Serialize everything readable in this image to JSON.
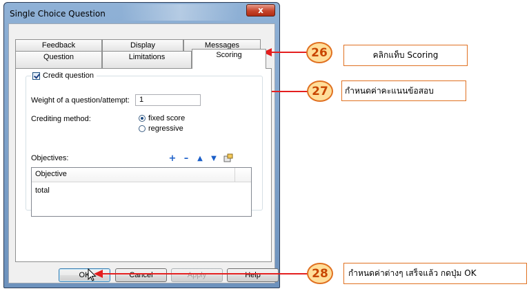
{
  "dialog": {
    "title": "Single Choice Question",
    "close_label": "x"
  },
  "tabs": {
    "back_row": [
      "Feedback",
      "Display",
      "Messages"
    ],
    "front_row": [
      "Question",
      "Limitations",
      "Scoring"
    ],
    "active": "Scoring"
  },
  "scoring": {
    "credit_checkbox_label": "Credit question",
    "credit_checked": true,
    "weight_label": "Weight of a question/attempt:",
    "weight_value": "1",
    "crediting_label": "Crediting method:",
    "crediting_options": [
      "fixed score",
      "regressive"
    ],
    "crediting_selected": "fixed score",
    "objectives_label": "Objectives:",
    "objective_tools": [
      "add-icon",
      "remove-icon",
      "move-up-icon",
      "move-down-icon",
      "properties-icon"
    ],
    "table_header": "Objective",
    "table_rows": [
      "total"
    ]
  },
  "buttons": {
    "ok": "OK",
    "cancel": "Cancel",
    "apply": "Apply",
    "help": "Help"
  },
  "annotations": [
    {
      "number": "26",
      "text": "คลิกแท็บ Scoring"
    },
    {
      "number": "27",
      "text": "กำหนดค่าคะแนนข้อสอบ"
    },
    {
      "number": "28",
      "text": "กำหนดค่าต่างๆ เสร็จแล้ว กดปุ่ม OK"
    }
  ],
  "colors": {
    "annotation_border": "#e07020",
    "annotation_fill": "#ffde9a",
    "arrow": "#e41e1e"
  }
}
